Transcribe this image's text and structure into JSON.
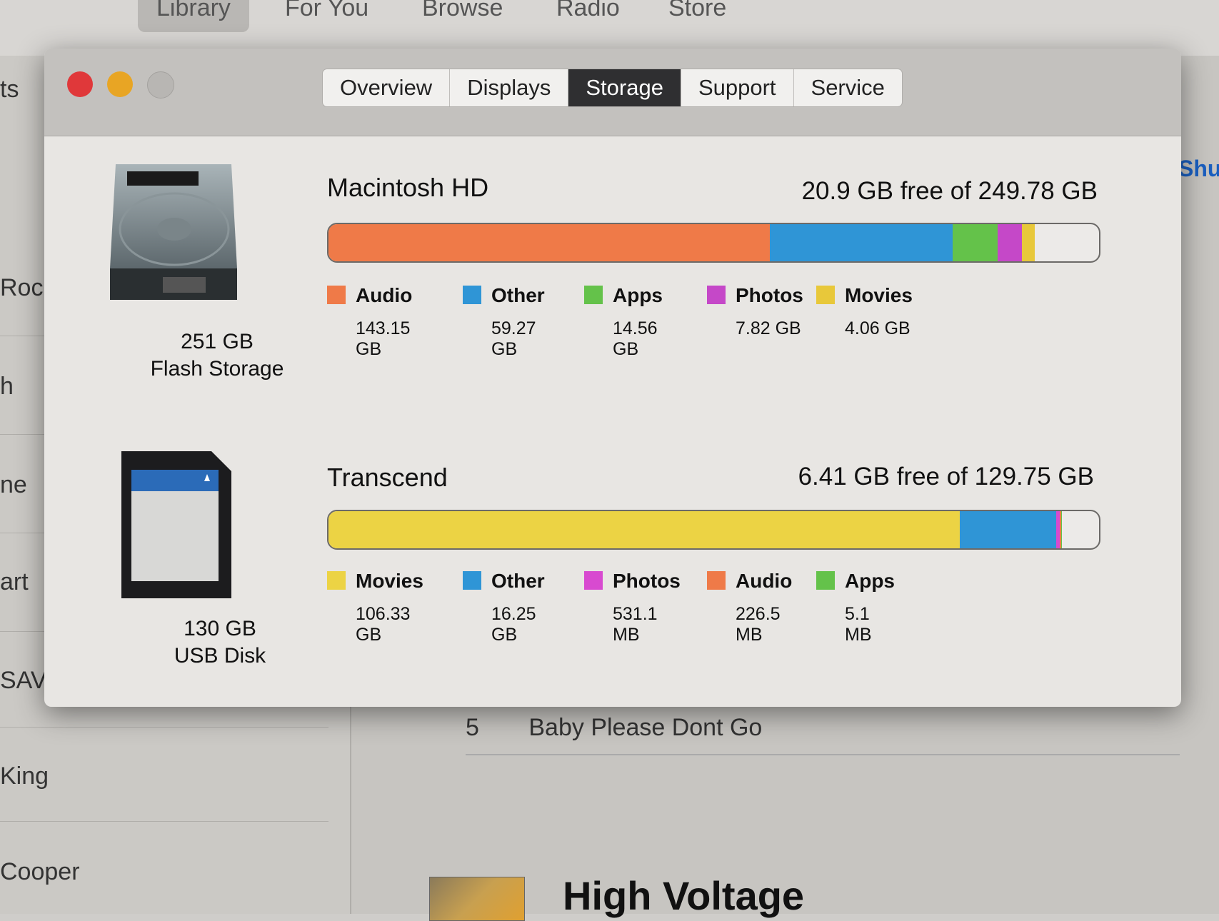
{
  "background": {
    "top_tabs": [
      {
        "label": "Library",
        "selected": true
      },
      {
        "label": "For You"
      },
      {
        "label": "Browse"
      },
      {
        "label": "Radio"
      },
      {
        "label": "Store"
      }
    ],
    "sidebar_fragments": [
      "ts",
      "Roc",
      "h",
      "ne",
      "art",
      "SAVA",
      "King",
      "Cooper"
    ],
    "shuffle_fragment": "Shuf",
    "track_number": "5",
    "track_title": "Baby Please Dont Go",
    "album_title": "High Voltage"
  },
  "window": {
    "tabs": [
      {
        "label": "Overview"
      },
      {
        "label": "Displays"
      },
      {
        "label": "Storage",
        "selected": true
      },
      {
        "label": "Support"
      },
      {
        "label": "Service"
      }
    ],
    "traffic_light_colors": {
      "close": "#e0383a",
      "minimize": "#e8a524",
      "zoom": "#b8b6b3"
    }
  },
  "disks": [
    {
      "icon": "hard-drive-icon",
      "capacity_label": "251 GB",
      "type_label": "Flash Storage",
      "volume_name": "Macintosh HD",
      "free_label": "20.9 GB free of 249.78 GB",
      "capacity_gb": 249.78,
      "categories": [
        {
          "name": "Audio",
          "size": "143.15 GB",
          "gb": 143.15,
          "color": "#ef7a48"
        },
        {
          "name": "Other",
          "size": "59.27 GB",
          "gb": 59.27,
          "color": "#2f95d6"
        },
        {
          "name": "Apps",
          "size": "14.56 GB",
          "gb": 14.56,
          "color": "#64c24a"
        },
        {
          "name": "Photos",
          "size": "7.82 GB",
          "gb": 7.82,
          "color": "#c548c8"
        },
        {
          "name": "Movies",
          "size": "4.06 GB",
          "gb": 4.06,
          "color": "#e8c83a"
        }
      ]
    },
    {
      "icon": "sd-card-icon",
      "capacity_label": "130 GB",
      "type_label": "USB Disk",
      "volume_name": "Transcend",
      "free_label": "6.41 GB free of 129.75 GB",
      "capacity_gb": 129.75,
      "categories": [
        {
          "name": "Movies",
          "size": "106.33 GB",
          "gb": 106.33,
          "color": "#ecd344"
        },
        {
          "name": "Other",
          "size": "16.25 GB",
          "gb": 16.25,
          "color": "#2f95d6"
        },
        {
          "name": "Photos",
          "size": "531.1 MB",
          "gb": 0.5311,
          "color": "#d84ad0"
        },
        {
          "name": "Audio",
          "size": "226.5 MB",
          "gb": 0.2265,
          "color": "#ef7a48"
        },
        {
          "name": "Apps",
          "size": "5.1 MB",
          "gb": 0.0051,
          "color": "#64c24a"
        }
      ]
    }
  ]
}
